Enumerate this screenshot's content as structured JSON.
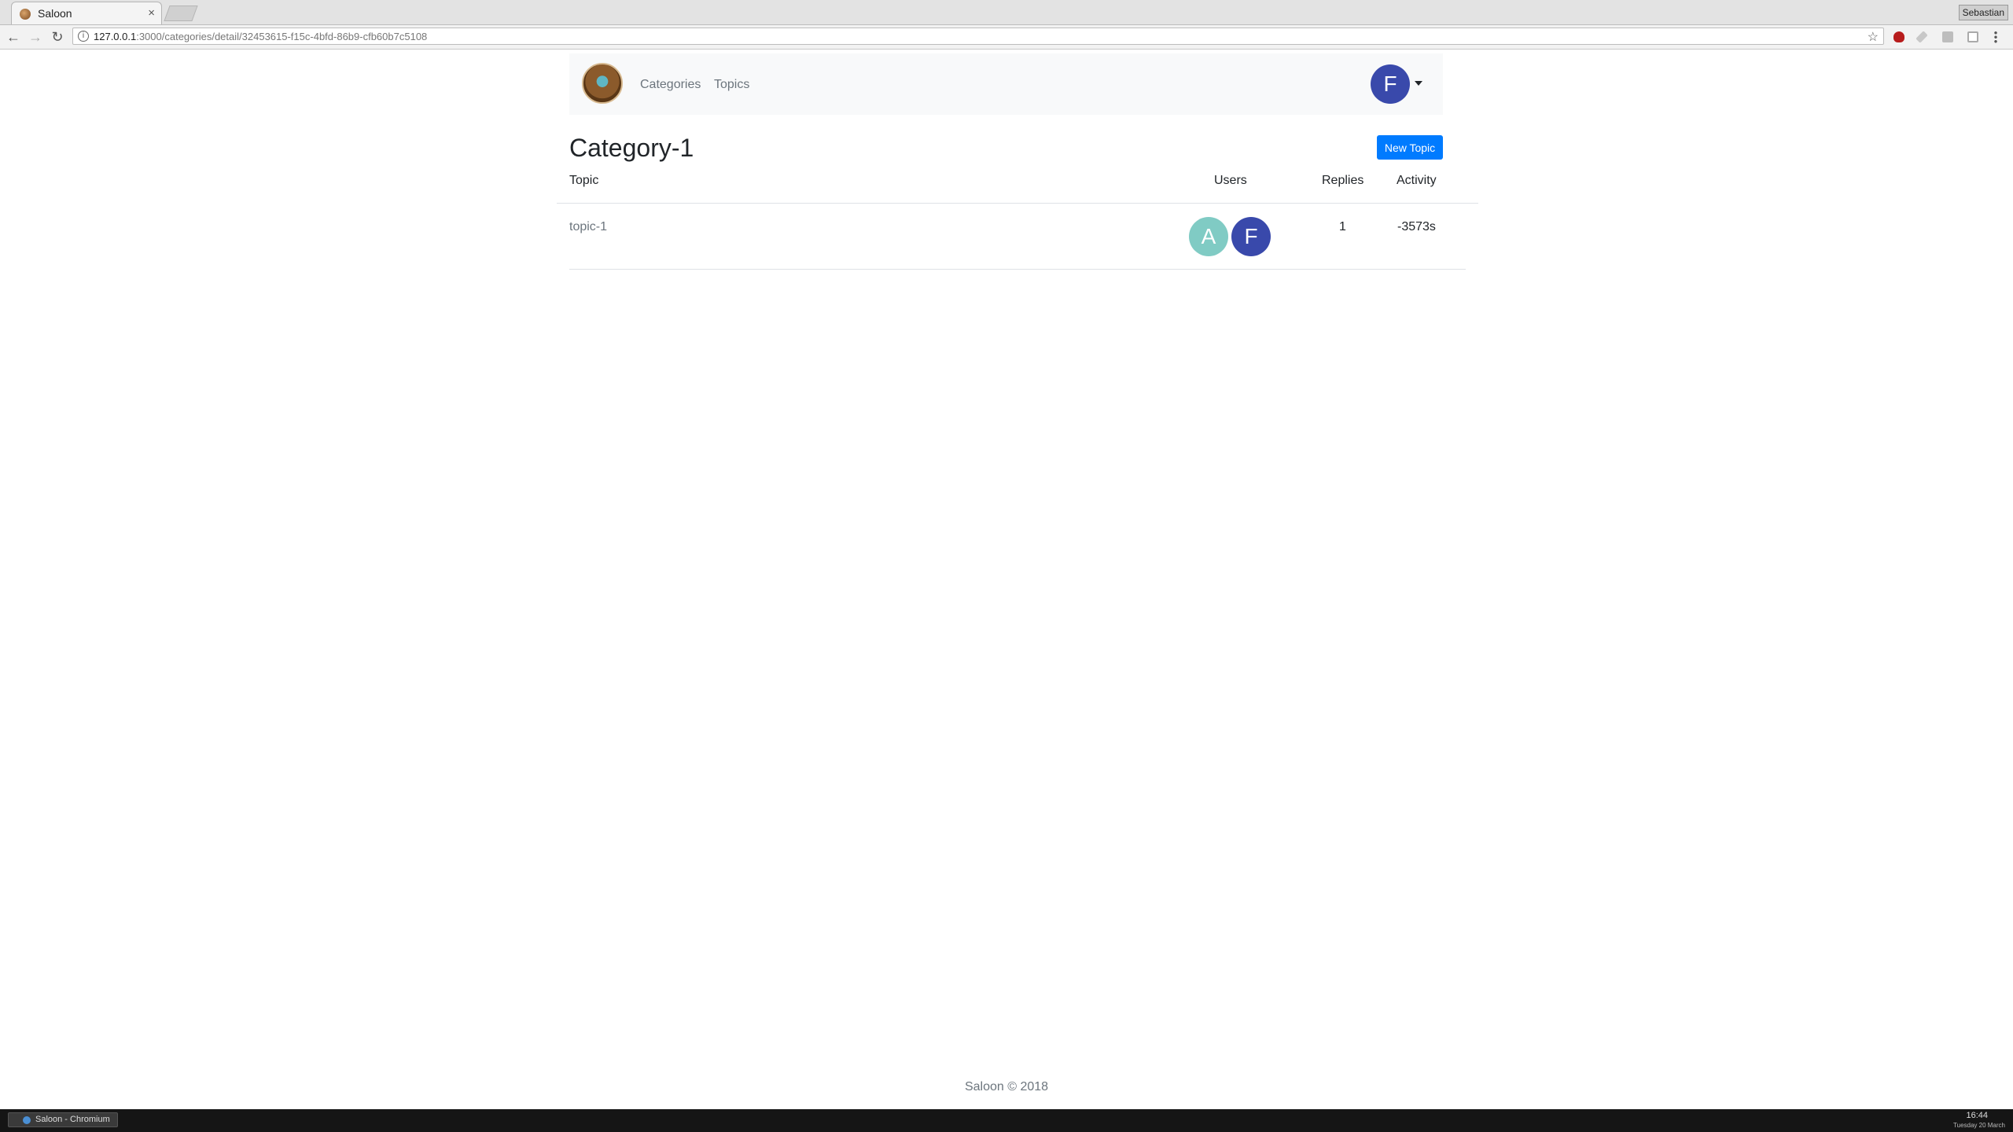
{
  "browser": {
    "tab_title": "Saloon",
    "tab_close": "×",
    "url_host": "127.0.0.1",
    "url_rest": ":3000/categories/detail/32453615-f15c-4bfd-86b9-cfb60b7c5108",
    "profile_name": "Sebastian"
  },
  "navbar": {
    "links": [
      "Categories",
      "Topics"
    ],
    "user_initial": "F"
  },
  "page": {
    "title": "Category-1",
    "new_topic_label": "New Topic"
  },
  "table": {
    "headers": {
      "topic": "Topic",
      "users": "Users",
      "replies": "Replies",
      "activity": "Activity"
    },
    "rows": [
      {
        "topic": "topic-1",
        "users": [
          {
            "initial": "A",
            "color": "#80cbc4"
          },
          {
            "initial": "F",
            "color": "#3949ab"
          }
        ],
        "replies": "1",
        "activity": "-3573s"
      }
    ]
  },
  "footer": {
    "text": "Saloon © 2018"
  },
  "taskbar": {
    "window_label": "Saloon - Chromium",
    "time": "16:44",
    "date": "Tuesday 20 March"
  },
  "colors": {
    "primary": "#007bff",
    "avatar_f": "#3949ab",
    "avatar_a": "#80cbc4"
  }
}
